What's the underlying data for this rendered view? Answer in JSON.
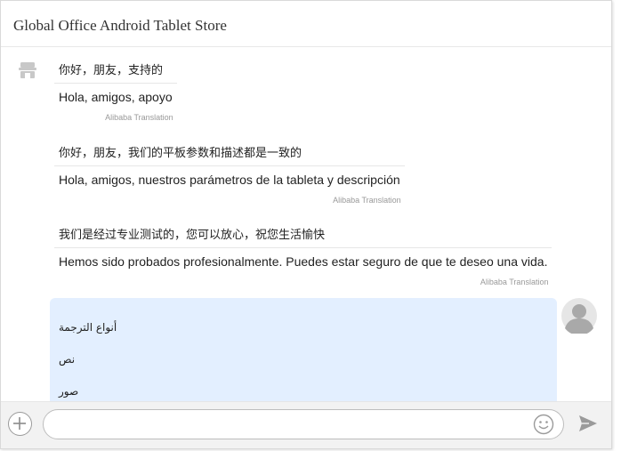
{
  "header": {
    "title": "Global Office Android Tablet Store"
  },
  "messages": [
    {
      "original": "你好，朋友，支持的",
      "translated": "Hola, amigos, apoyo",
      "credit": "Alibaba Translation"
    },
    {
      "original": "你好，朋友，我们的平板参数和描述都是一致的",
      "translated": "Hola, amigos, nuestros parámetros de la tableta y descripción",
      "credit": "Alibaba Translation"
    },
    {
      "original": "我们是经过专业测试的，您可以放心，祝您生活愉快",
      "translated": "Hemos sido probados profesionalmente. Puedes estar seguro de que te deseo una vida.",
      "credit": "Alibaba Translation"
    }
  ],
  "user_message": {
    "lines": [
      "أنواع الترجمة",
      "نص",
      "صور"
    ]
  },
  "input": {
    "value": "",
    "placeholder": ""
  },
  "icons": {
    "store_avatar": "store-icon",
    "user_avatar": "user-avatar-icon",
    "add": "plus-circle-icon",
    "emoji": "smiley-icon",
    "send": "paper-plane-icon"
  },
  "colors": {
    "bubble_background": "#e3efff",
    "header_text": "#333333",
    "credit_text": "#999999"
  }
}
